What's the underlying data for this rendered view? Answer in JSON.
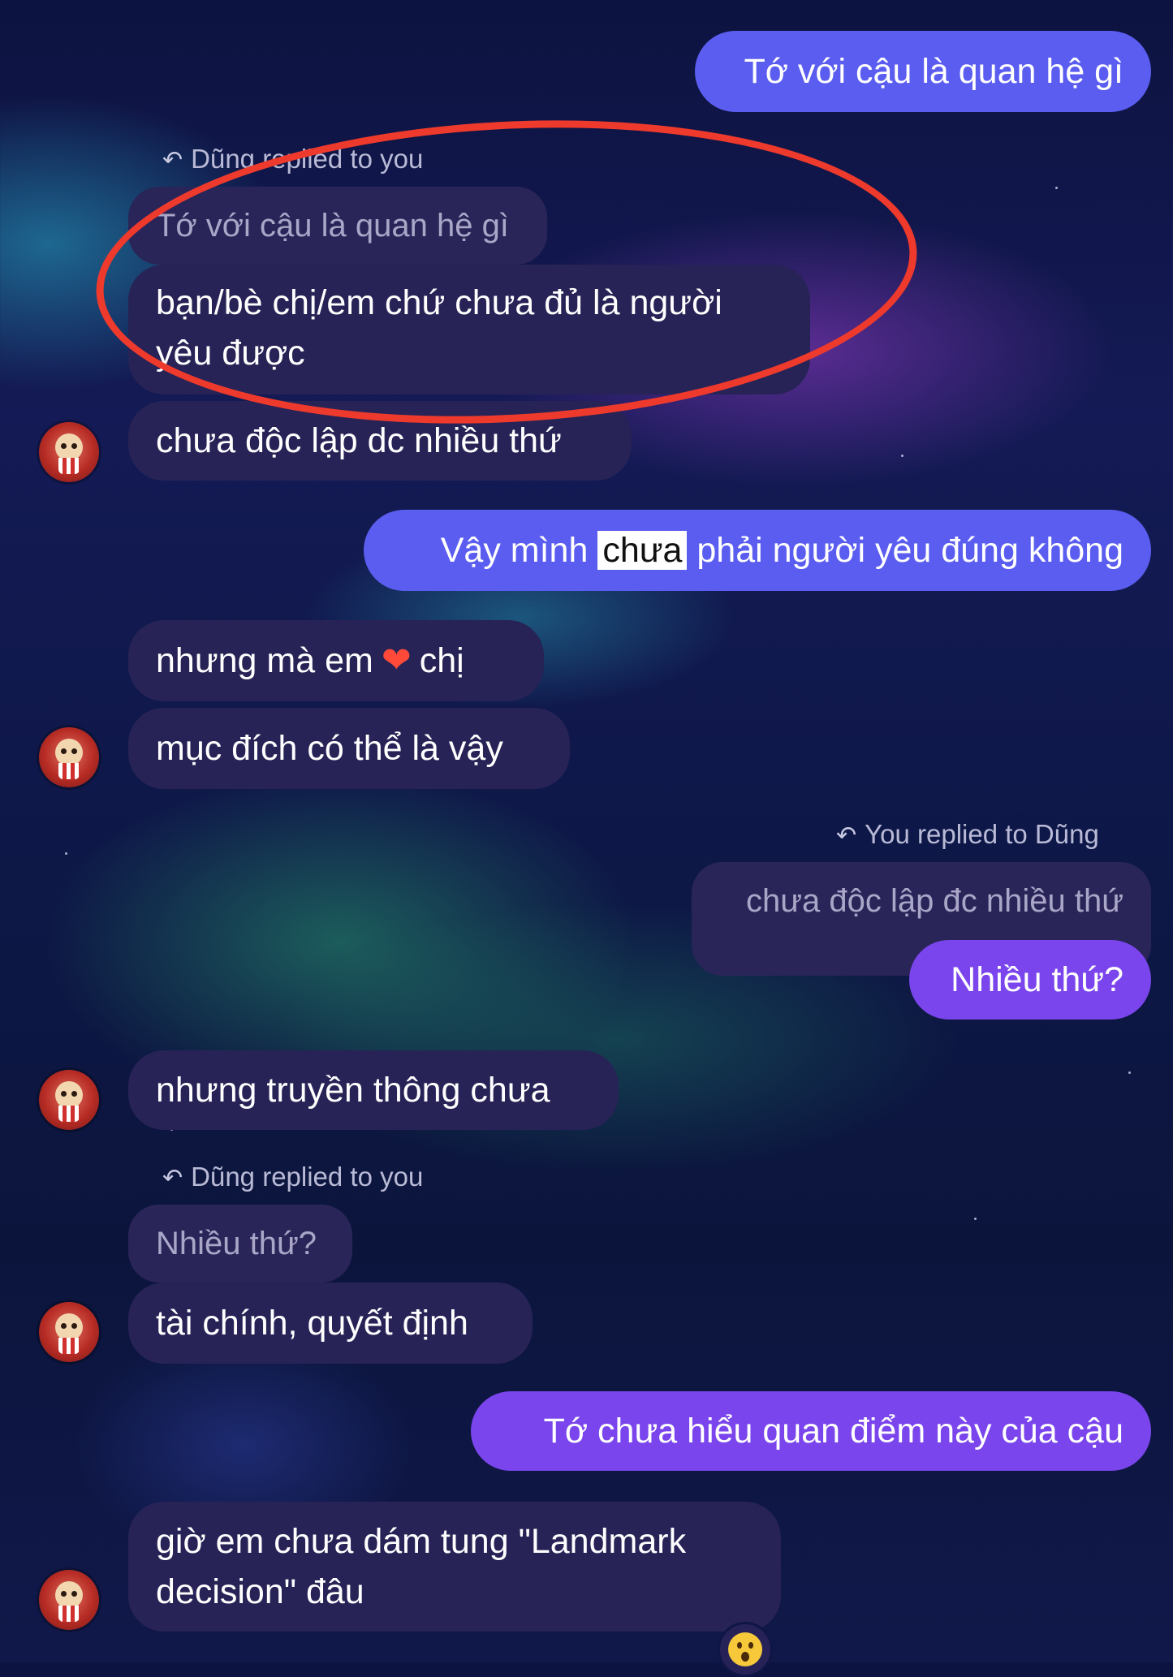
{
  "messages": {
    "m1": "Tớ với cậu là quan hệ gì",
    "reply1_meta": "Dũng replied to you",
    "reply1_quote": "Tớ với cậu là quan hệ gì",
    "reply1_text_line1": "bạn/bè chị/em chứ chưa đủ là người",
    "reply1_text_line2": "yêu được",
    "m3": "chưa độc lập dc nhiều thứ",
    "m4_before": "Vậy mình",
    "m4_highlight": "chưa",
    "m4_after": "phải người yêu đúng không",
    "m5_before": "nhưng mà em",
    "m5_emoji": "❤",
    "m5_after": "chị",
    "m6": "mục đích có thể là vậy",
    "reply2_meta": "You replied to Dũng",
    "reply2_quote": "chưa độc lập đc nhiều thứ",
    "reply2_text": "Nhiều thứ?",
    "m8": "nhưng truyền thông chưa",
    "reply3_meta": "Dũng replied to you",
    "reply3_quote": "Nhiều thứ?",
    "reply3_text": "tài chính, quyết định",
    "m10": "Tớ chưa hiểu quan điểm này của cậu",
    "m11_line1": "giờ em chưa dám tung \"Landmark",
    "m11_line2": "decision\" đâu"
  },
  "icons": {
    "reply_arrow": "reply-arrow-icon",
    "avatar": "popcorn-character-avatar",
    "reaction": "surprised-face-emoji",
    "heart": "fire-heart-emoji"
  },
  "colors": {
    "outgoing_blue": "#5a5df0",
    "outgoing_purple": "#7a45ec",
    "incoming": "#272356",
    "annotation_circle": "#ee3a2c"
  }
}
